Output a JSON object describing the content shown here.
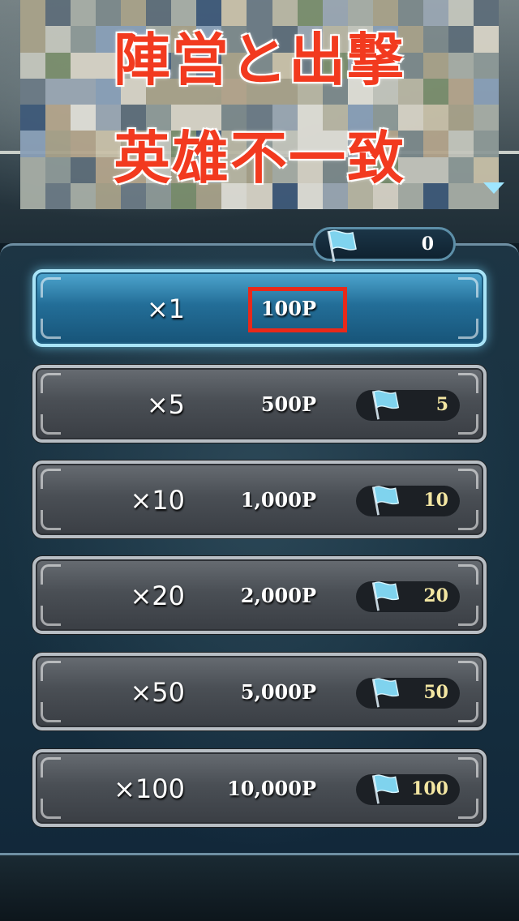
{
  "overlay": {
    "line1": "陣営と出撃",
    "line2": "英雄不一致"
  },
  "flag_counter": {
    "value": "0"
  },
  "colors": {
    "accent_red": "#e8291a",
    "flag_blue": "#7fd3ee",
    "flag_count_text": "#f3e6a2"
  },
  "options": [
    {
      "multiplier": "×1",
      "price": "100P",
      "flags": "",
      "selected": true
    },
    {
      "multiplier": "×5",
      "price": "500P",
      "flags": "5",
      "selected": false
    },
    {
      "multiplier": "×10",
      "price": "1,000P",
      "flags": "10",
      "selected": false
    },
    {
      "multiplier": "×20",
      "price": "2,000P",
      "flags": "20",
      "selected": false
    },
    {
      "multiplier": "×50",
      "price": "5,000P",
      "flags": "50",
      "selected": false
    },
    {
      "multiplier": "×100",
      "price": "10,000P",
      "flags": "100",
      "selected": false
    }
  ]
}
